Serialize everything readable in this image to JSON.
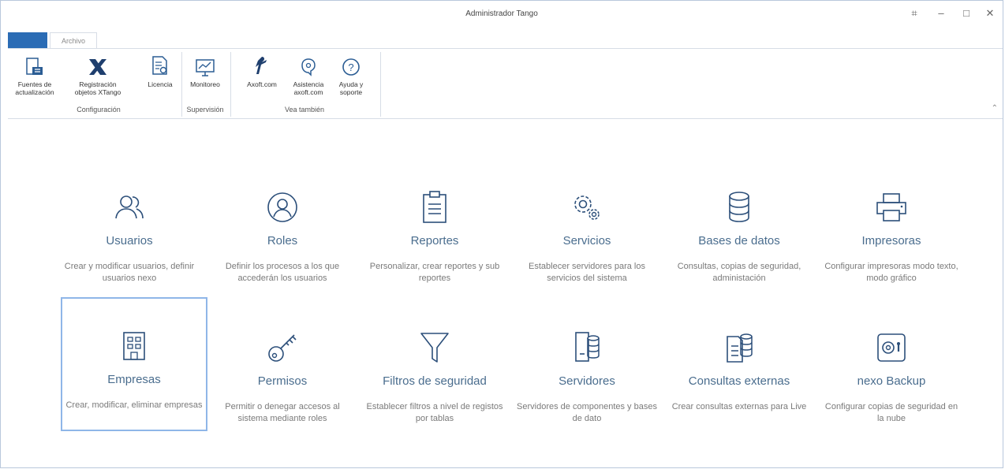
{
  "window": {
    "title": "Administrador Tango"
  },
  "ribbon": {
    "tab": "Archivo",
    "buttons": {
      "fuentes": "Fuentes de\nactualización",
      "registracion": "Registración\nobjetos XTango",
      "licencia": "Licencia",
      "monitoreo": "Monitoreo",
      "axoft": "Axoft.com",
      "asistencia": "Asistencia\naxoft.com",
      "ayuda": "Ayuda y\nsoporte"
    },
    "groups": {
      "configuracion": "Configuración",
      "supervision": "Supervisión",
      "vea": "Vea también"
    }
  },
  "tiles": [
    {
      "title": "Usuarios",
      "desc": "Crear y modificar usuarios, definir usuarios nexo",
      "icon": "users-icon"
    },
    {
      "title": "Roles",
      "desc": "Definir los procesos a los que accederán los usuarios",
      "icon": "user-circle-icon"
    },
    {
      "title": "Reportes",
      "desc": "Personalizar, crear reportes y sub reportes",
      "icon": "clipboard-icon"
    },
    {
      "title": "Servicios",
      "desc": "Establecer servidores para los servicios del sistema",
      "icon": "gears-icon"
    },
    {
      "title": "Bases de datos",
      "desc": "Consultas, copias de seguridad, administación",
      "icon": "database-icon"
    },
    {
      "title": "Impresoras",
      "desc": "Configurar impresoras modo texto, modo gráfico",
      "icon": "printer-icon"
    },
    {
      "title": "Empresas",
      "desc": "Crear, modificar, eliminar empresas",
      "icon": "building-icon"
    },
    {
      "title": "Permisos",
      "desc": "Permitir o denegar accesos al sistema mediante roles",
      "icon": "key-icon"
    },
    {
      "title": "Filtros de seguridad",
      "desc": "Establecer filtros a nivel de registos por tablas",
      "icon": "filter-icon"
    },
    {
      "title": "Servidores",
      "desc": "Servidores de componentes y bases de dato",
      "icon": "server-icon"
    },
    {
      "title": "Consultas externas",
      "desc": "Crear consultas externas para Live",
      "icon": "documents-icon"
    },
    {
      "title": "nexo Backup",
      "desc": "Configurar copias de seguridad en la nube",
      "icon": "safe-icon"
    }
  ]
}
